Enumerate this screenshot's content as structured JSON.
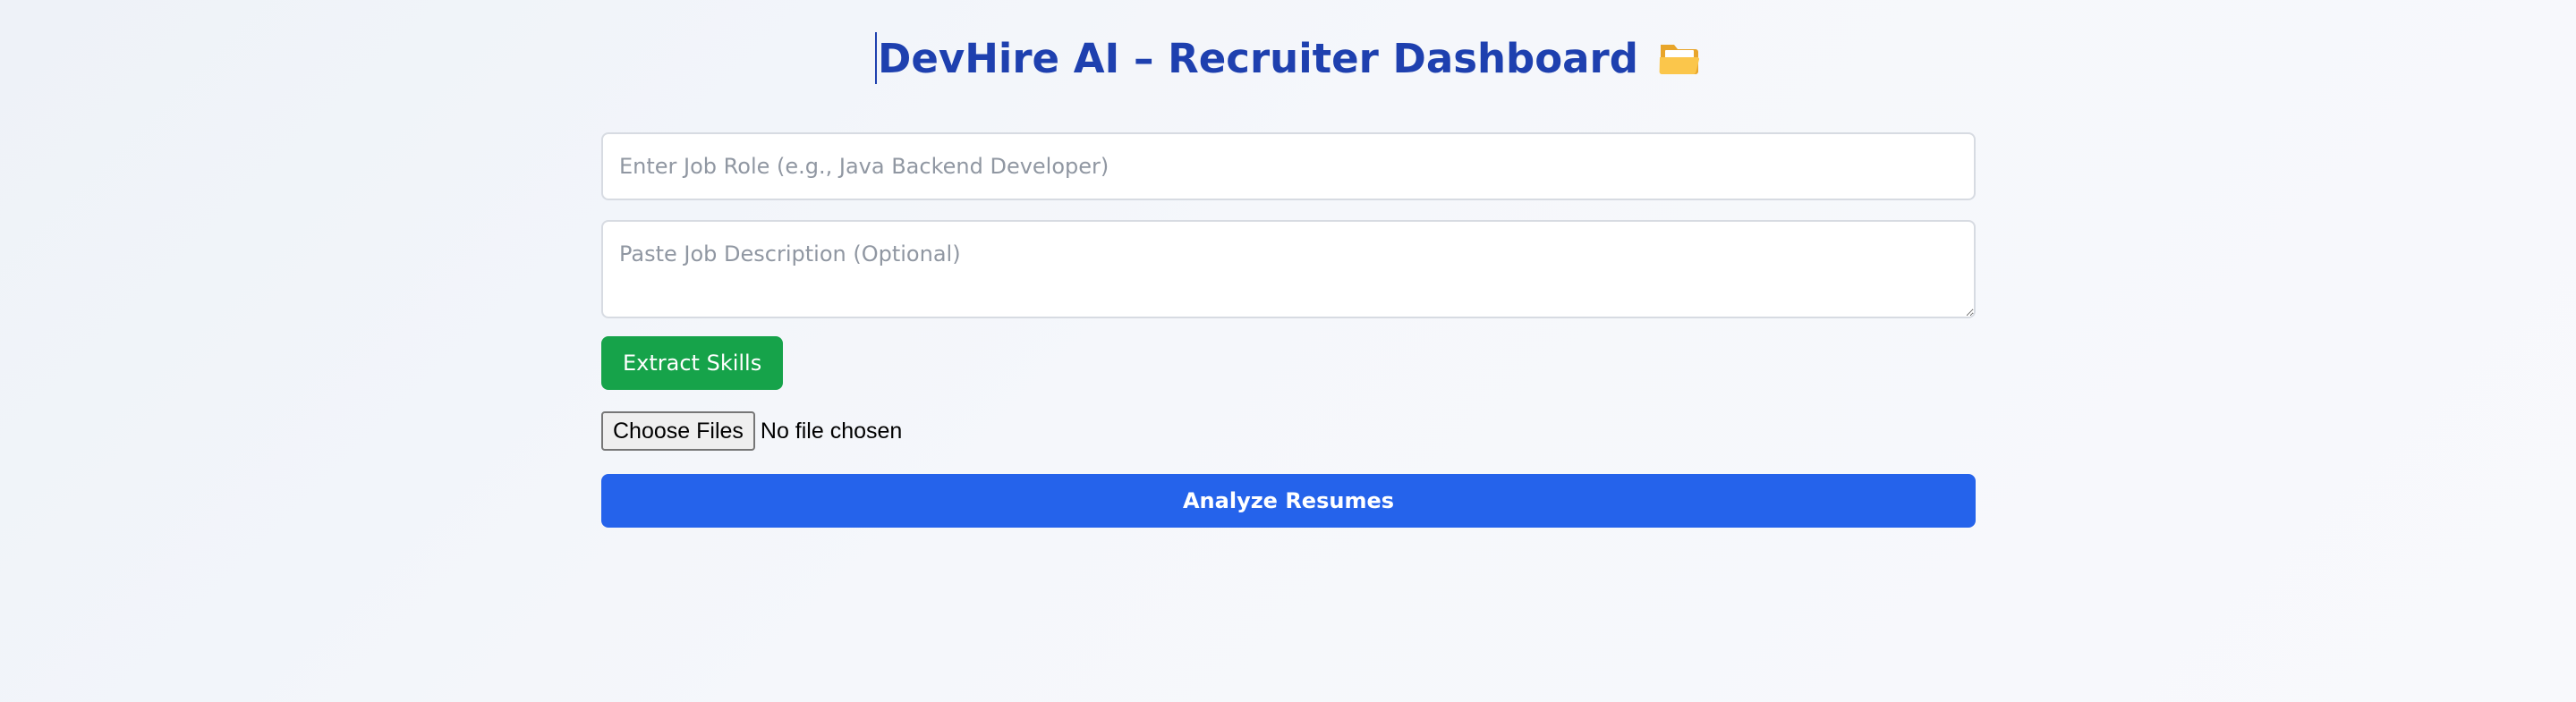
{
  "header": {
    "title": "DevHire AI – Recruiter Dashboard",
    "title_icon": "open-folder-icon"
  },
  "form": {
    "job_role": {
      "value": "",
      "placeholder": "Enter Job Role (e.g., Java Backend Developer)"
    },
    "job_description": {
      "value": "",
      "placeholder": "Paste Job Description (Optional)"
    },
    "extract_label": "Extract Skills",
    "file_upload": {
      "button_label": "Choose Files",
      "status": "No file chosen"
    },
    "analyze_label": "Analyze Resumes"
  },
  "colors": {
    "title": "#1e40af",
    "extract_button": "#16a34a",
    "analyze_button": "#2563eb"
  }
}
